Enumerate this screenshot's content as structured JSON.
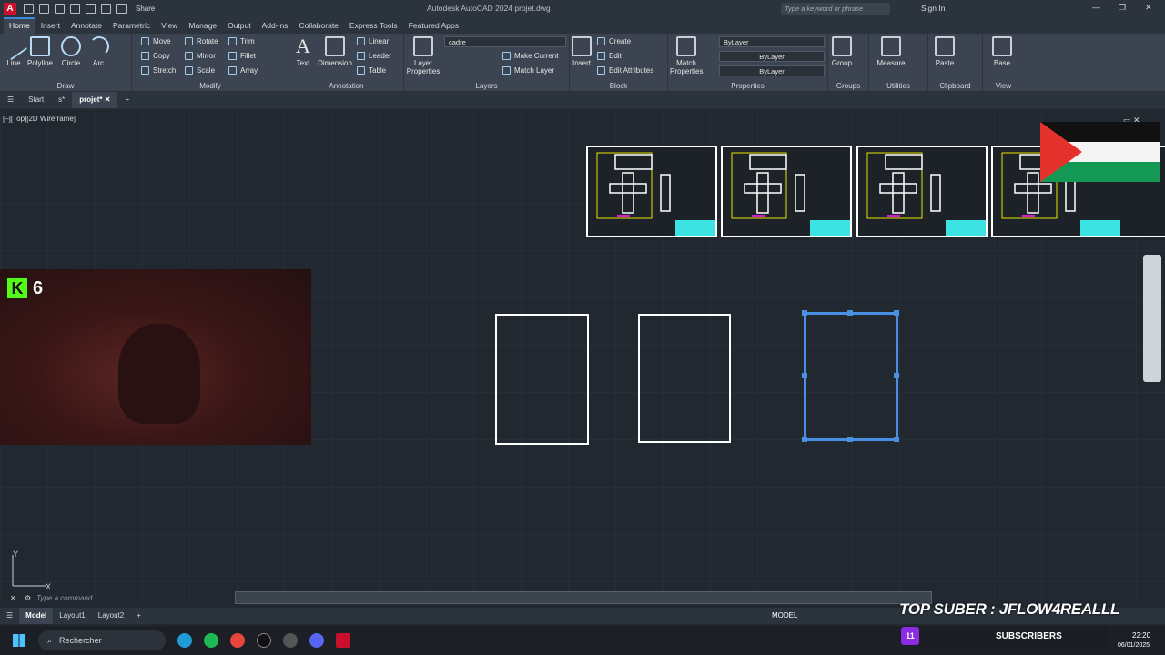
{
  "titlebar": {
    "logo": "A",
    "share": "Share",
    "title": "Autodesk AutoCAD 2024    projet.dwg",
    "search_placeholder": "Type a keyword or phrase",
    "signin": "Sign In"
  },
  "tabs": [
    "Home",
    "Insert",
    "Annotate",
    "Parametric",
    "View",
    "Manage",
    "Output",
    "Add-ins",
    "Collaborate",
    "Express Tools",
    "Featured Apps"
  ],
  "ribbon": {
    "draw": {
      "title": "Draw",
      "line": "Line",
      "polyline": "Polyline",
      "circle": "Circle",
      "arc": "Arc"
    },
    "modify": {
      "title": "Modify",
      "move": "Move",
      "rotate": "Rotate",
      "trim": "Trim",
      "copy": "Copy",
      "mirror": "Mirror",
      "fillet": "Fillet",
      "stretch": "Stretch",
      "scale": "Scale",
      "array": "Array"
    },
    "annotation": {
      "title": "Annotation",
      "text": "Text",
      "dimension": "Dimension",
      "linear": "Linear",
      "leader": "Leader",
      "table": "Table"
    },
    "layers": {
      "title": "Layers",
      "layer_properties": "Layer Properties",
      "current_layer": "cadre",
      "make_current": "Make Current",
      "match_layer": "Match Layer"
    },
    "block": {
      "title": "Block",
      "insert": "Insert",
      "create": "Create",
      "edit": "Edit",
      "edit_attributes": "Edit Attributes"
    },
    "properties": {
      "title": "Properties",
      "match_properties": "Match Properties",
      "color": "ByLayer",
      "linetype": "ByLayer",
      "lineweight": "ByLayer"
    },
    "groups": {
      "title": "Groups",
      "group": "Group"
    },
    "utilities": {
      "title": "Utilities",
      "measure": "Measure"
    },
    "clipboard": {
      "title": "Clipboard",
      "paste": "Paste"
    },
    "view": {
      "title": "View",
      "base": "Base"
    }
  },
  "doctabs": {
    "start": "Start",
    "s": "s*",
    "projet": "projet*"
  },
  "canvas": {
    "view_label": "[–][Top][2D Wireframe]",
    "axis_y": "Y",
    "axis_x": "X"
  },
  "command": {
    "placeholder": "Type a command"
  },
  "status": {
    "model_tab": "Model",
    "layout1": "Layout1",
    "layout2": "Layout2",
    "model_label": "MODEL"
  },
  "taskbar": {
    "search": "Rechercher",
    "time": "22:20",
    "date": "06/01/2025"
  },
  "stream": {
    "kick_count": "6",
    "top_suber": "TOP SUBER : JFLOW4REALLL",
    "sub_count": "11",
    "subscribers": "SUBSCRIBERS"
  },
  "colors": {
    "accent": "#3b89d8",
    "selection": "#4a90e2",
    "drawing_yellow": "#e6e600",
    "drawing_cyan": "#3de3e3",
    "drawing_magenta": "#d020d0"
  }
}
